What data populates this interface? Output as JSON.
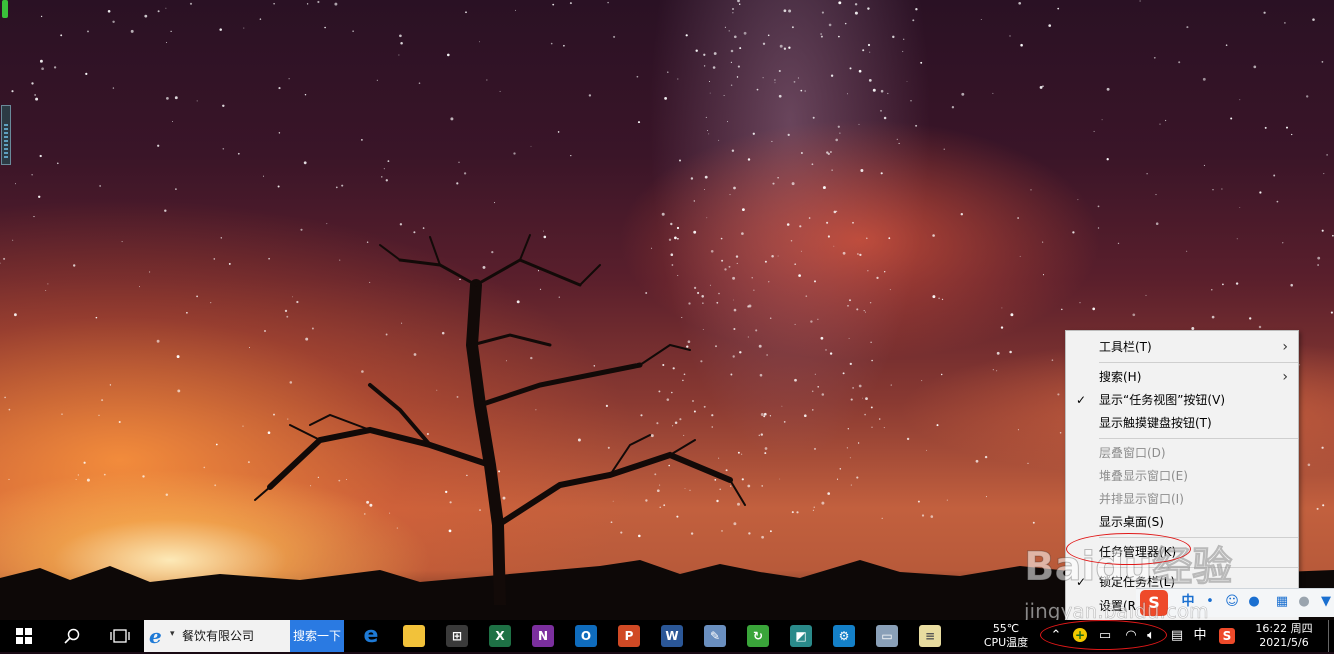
{
  "context_menu": {
    "items": [
      {
        "label": "工具栏(T)",
        "submenu": true,
        "checked": false,
        "disabled": false
      },
      {
        "label": "搜索(H)",
        "submenu": true,
        "checked": false,
        "disabled": false
      },
      {
        "label": "显示“任务视图”按钮(V)",
        "submenu": false,
        "checked": true,
        "disabled": false
      },
      {
        "label": "显示触摸键盘按钮(T)",
        "submenu": false,
        "checked": false,
        "disabled": false
      },
      {
        "label": "层叠窗口(D)",
        "submenu": false,
        "checked": false,
        "disabled": true
      },
      {
        "label": "堆叠显示窗口(E)",
        "submenu": false,
        "checked": false,
        "disabled": true
      },
      {
        "label": "并排显示窗口(I)",
        "submenu": false,
        "checked": false,
        "disabled": true
      },
      {
        "label": "显示桌面(S)",
        "submenu": false,
        "checked": false,
        "disabled": false
      },
      {
        "label": "任务管理器(K)",
        "submenu": false,
        "checked": false,
        "disabled": false
      },
      {
        "label": "锁定任务栏(L)",
        "submenu": false,
        "checked": true,
        "disabled": false
      },
      {
        "label": "设置(R)",
        "submenu": false,
        "checked": false,
        "disabled": false
      }
    ],
    "check_glyph": "✓",
    "arrow_glyph": "›"
  },
  "taskbar": {
    "search_text": "餐饮有限公司",
    "search_button": "搜索一下",
    "search_caret": "▾",
    "apps": [
      {
        "name": "edge-icon",
        "glyph": "e",
        "color": "#1e7ad6"
      },
      {
        "name": "file-explorer-icon",
        "glyph": "",
        "color": "#f2c23a"
      },
      {
        "name": "store-icon",
        "glyph": "⊞",
        "color": "#3a3a3a"
      },
      {
        "name": "excel-icon",
        "glyph": "X",
        "color": "#1e7145"
      },
      {
        "name": "onenote-icon",
        "glyph": "N",
        "color": "#7b2f9e"
      },
      {
        "name": "outlook-icon",
        "glyph": "O",
        "color": "#0f6cbd"
      },
      {
        "name": "powerpoint-icon",
        "glyph": "P",
        "color": "#d04a25"
      },
      {
        "name": "word-icon",
        "glyph": "W",
        "color": "#2b5797"
      },
      {
        "name": "paint-icon",
        "glyph": "✎",
        "color": "#6a8fbf"
      },
      {
        "name": "update-icon",
        "glyph": "↻",
        "color": "#3aa53a"
      },
      {
        "name": "photos-icon",
        "glyph": "◩",
        "color": "#2a8a8a"
      },
      {
        "name": "settings-app-icon",
        "glyph": "⚙",
        "color": "#1480c8"
      },
      {
        "name": "remote-desktop-icon",
        "glyph": "▭",
        "color": "#8aa0b8"
      },
      {
        "name": "notepad-icon",
        "glyph": "≡",
        "color": "#e8dca0"
      }
    ],
    "temp_value": "55℃",
    "temp_label": "CPU温度",
    "ime_lang": "中",
    "time": "16:22 周四",
    "date": "2021/5/6"
  },
  "ime_toolbar": {
    "logo": "S",
    "mode": "中"
  },
  "watermark": {
    "text": "Baidu经验",
    "url": "jingyan.baidu.com"
  }
}
